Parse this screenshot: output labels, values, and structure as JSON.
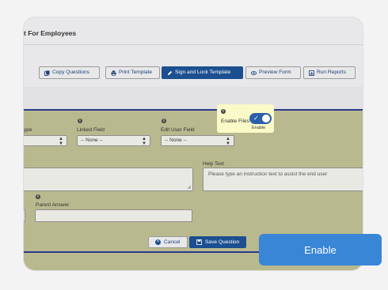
{
  "header": {
    "title": "t For Employees"
  },
  "toolbar": {
    "copy_questions": "Copy Questions",
    "print_template": "Print Template",
    "sign_and_lock": "Sign and Lock Template",
    "preview_form": "Preview Form",
    "run_reports": "Run Reports"
  },
  "form": {
    "type_label": "ype",
    "linked_field_label": "Linked Field",
    "linked_field_value": "-- None --",
    "edit_user_field_label": "Edit User Field",
    "edit_user_field_value": "-- None --",
    "enable_files_label": "Enable Files",
    "enable_files_state": "Enable",
    "help_text_label": "Help Text",
    "help_text_placeholder": "Please type an instruction text to assist the end user",
    "parent_answer_label": "Parent Answer",
    "cancel_label": "Cancel",
    "save_label": "Save Question"
  },
  "tooltip": {
    "text": "Enable"
  },
  "colors": {
    "primary": "#1c4f8f",
    "form_bg": "#b9b98f",
    "highlight": "#fafac8",
    "tooltip": "#3a86d6"
  }
}
